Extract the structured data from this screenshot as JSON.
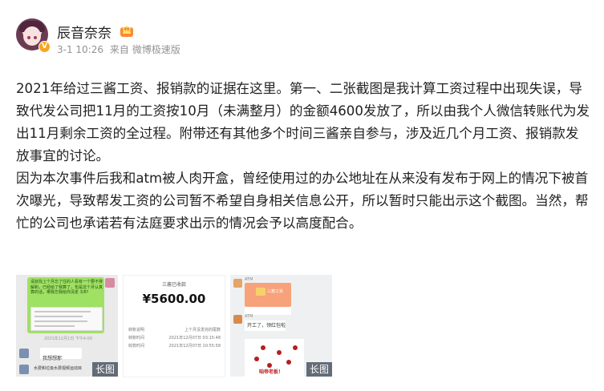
{
  "post": {
    "username": "辰音奈奈",
    "verified_badge": "V",
    "date": "3-1 10:26",
    "source_prefix": "来自",
    "source": "微博极速版",
    "paragraphs": [
      "2021年给过三酱工资、报销款的证据在这里。第一、二张截图是我计算工资过程中出现失误，导致代发公司把11月的工资按10月（未满整月）的金额4600发放了，所以由我个人微信转账代为发出11月剩余工资的全过程。附带还有其他多个时间三酱亲自参与，涉及近几个月工资、报销款发放事宜的讨论。",
      "因为本次事件后我和atm被人肉开盒，曾经使用过的办公地址在从来没有发布于网上的情况下被首次曝光，导致帮发工资的公司暂不希望自身相关信息公开，所以暂时只能出示这个截图。当然，帮忙的公司也承诺若有法庭要求出示的情况会予以高度配合。"
    ],
    "images": [
      {
        "tag": "长图",
        "chat_lines": [
          "请叔找上个月忘了住的人看有一个要不排解和，已经给了我算了，包是这个月认真算的话，哪我忘我给你清走 3/8?"
        ],
        "date_text": "2021年12月1日 下午4:00",
        "reply": "我想想那",
        "bottom_text": "水费和垃圾水费视频运动目"
      },
      {
        "tag": "",
        "header": "三酱已收款",
        "amount": "¥5600.00",
        "rows": [
          {
            "label": "转账说明",
            "value": "上个月没发完的尾数"
          },
          {
            "label": "转账时间",
            "value": "2021年12月07日 03:15:48"
          },
          {
            "label": "收款时间",
            "value": "2021年12月07日 10:55:58"
          }
        ]
      },
      {
        "tag": "长图",
        "name1": "ATM",
        "card_text": "三酱工资",
        "name2": "ATM",
        "reply": "开工了，领红包啦",
        "caption": "咱帝老板！"
      }
    ]
  },
  "colors": {
    "meta": "#939393",
    "text": "#222222",
    "badge": "#f6a623",
    "tag_bg": "#3c4655"
  },
  "icons": [
    "verified-icon",
    "crown-badge-icon"
  ]
}
